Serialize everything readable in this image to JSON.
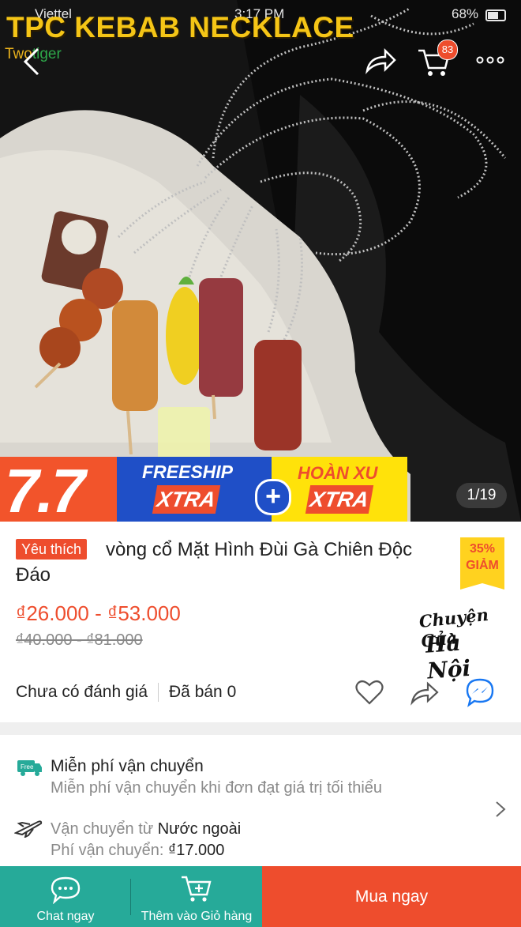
{
  "status_bar": {
    "carrier": "Viettel",
    "time": "3:17 PM",
    "battery": "68%"
  },
  "hero": {
    "banner_title": "TPC KEBAB NECKLACE",
    "brand_prefix": "Two",
    "brand_suffix": "tiger",
    "cart_count": "83",
    "image_counter": "1/19",
    "promo": {
      "big_number": "7.7",
      "freeship": "FREESHIP",
      "xtra": "XTRA",
      "plus": "+",
      "hoan_xu": "HOÀN XU"
    }
  },
  "product": {
    "favorite_badge": "Yêu thích",
    "title": "vòng cổ Mặt Hình Đùi Gà Chiên Độc Đáo",
    "discount_percent": "35%",
    "discount_label": "GIẢM",
    "price_range": "₫26.000 - ₫53.000",
    "original_price_range": "₫40.000 - ₫81.000",
    "shop_logo_line1": "Chuyện Của",
    "shop_logo_line2": "Hà Nội",
    "rating_text": "Chưa có đánh giá",
    "sold_text": "Đã bán 0"
  },
  "shipping": {
    "free_ship_badge": "Free",
    "free_ship_title": "Miễn phí vận chuyển",
    "free_ship_desc": "Miễn phí vận chuyển khi đơn đạt giá trị tối thiểu",
    "origin_label": "Vận chuyển từ ",
    "origin_value": "Nước ngoài",
    "fee_label": "Phí vận chuyển: ",
    "fee_value": "₫17.000"
  },
  "bottom_bar": {
    "chat_label": "Chat ngay",
    "add_to_cart_label": "Thêm vào Giỏ hàng",
    "buy_now_label": "Mua ngay"
  },
  "colors": {
    "accent": "#ee4d2d",
    "teal": "#26aa99",
    "promo_blue": "#1f4fc7",
    "promo_yellow": "#ffe20a"
  }
}
